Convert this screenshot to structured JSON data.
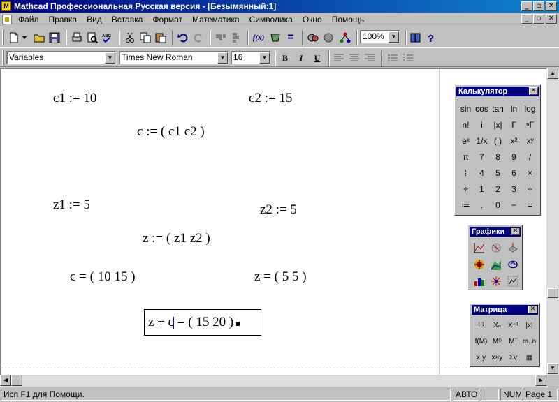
{
  "window": {
    "title": "Mathcad Профессиональная Русская версия - [Безымянный:1]",
    "app_icon": "mathcad-icon",
    "controls": {
      "minimize": "_",
      "maximize": "▫",
      "close": "✕"
    }
  },
  "menu": [
    "Файл",
    "Правка",
    "Вид",
    "Вставка",
    "Формат",
    "Математика",
    "Символика",
    "Окно",
    "Помощь"
  ],
  "toolbar": {
    "zoom": "100%",
    "icons": [
      "new-document-icon",
      "open-folder-icon",
      "save-icon",
      "print-icon",
      "print-preview-icon",
      "spell-check-icon",
      "cut-icon",
      "copy-icon",
      "paste-icon",
      "undo-icon",
      "redo-icon",
      "align-horizontal-icon",
      "align-vertical-icon",
      "insert-function-icon",
      "insert-unit-icon",
      "calculate-icon",
      "component-icon",
      "resource-icon",
      "help-icon"
    ],
    "fx_label": "f(x)",
    "equals_label": "="
  },
  "format_toolbar": {
    "style": "Variables",
    "font": "Times New Roman",
    "size": "16",
    "bold": "B",
    "italic": "I",
    "underline": "U"
  },
  "worksheet": {
    "exprs": {
      "c1": "c1 := 10",
      "c2": "c2 := 15",
      "c": "c := ( c1   c2 )",
      "z1": "z1 := 5",
      "z2": "z2 := 5",
      "z": "z := ( z1   z2 )",
      "c_eval": "c = ( 10   15 )",
      "z_eval": "z = ( 5   5 )",
      "sum_left": "z + c",
      "sum_right": " = ( 15   20 )"
    }
  },
  "palettes": {
    "calculator": {
      "title": "Калькулятор",
      "buttons": [
        "sin",
        "cos",
        "tan",
        "ln",
        "log",
        "n!",
        "i",
        "|x|",
        "Г",
        "ⁿГ",
        "eˣ",
        "1/x",
        "( )",
        "x²",
        "xʸ",
        "π",
        "7",
        "8",
        "9",
        "/",
        "⁞",
        "4",
        "5",
        "6",
        "×",
        "÷",
        "1",
        "2",
        "3",
        "+",
        "≔",
        ".",
        "0",
        "−",
        "="
      ]
    },
    "graphs": {
      "title": "Графики",
      "buttons": [
        "xy-plot-icon",
        "polar-plot-icon",
        "surface-plot-icon",
        "contour-plot-icon",
        "3d-scatter-icon",
        "3d-bar-icon",
        "vector-field-icon",
        "3d-plot-wizard-icon",
        "animation-icon"
      ]
    },
    "matrix": {
      "title": "Матрица",
      "buttons": [
        "⁞⁞⁞",
        "Xₙ",
        "X⁻¹",
        "|x|",
        "f(M)",
        "M⁽⁾",
        "Mᵀ",
        "m..n",
        "x·y",
        "x×y",
        "Σv",
        "▦"
      ]
    }
  },
  "status": {
    "help": "Исп F1 для Помощи.",
    "auto": "АВТО",
    "num": "NUM",
    "page": "Page 1"
  }
}
